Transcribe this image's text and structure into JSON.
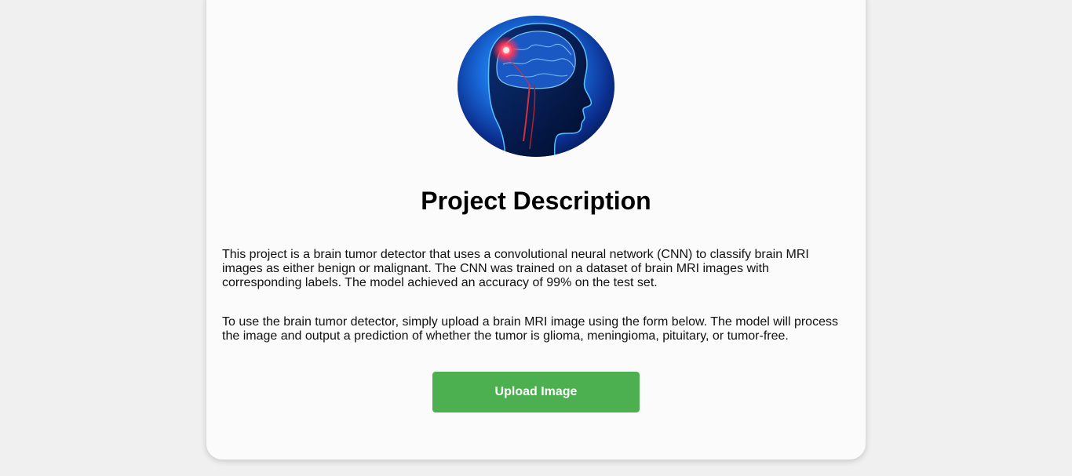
{
  "hero": {
    "image_subject": "brain-scan-head-illustration"
  },
  "main": {
    "title": "Project Description",
    "paragraph_1": "This project is a brain tumor detector that uses a convolutional neural network (CNN) to classify brain MRI images as either benign or malignant. The CNN was trained on a dataset of brain MRI images with corresponding labels. The model achieved an accuracy of 99% on the test set.",
    "paragraph_2": "To use the brain tumor detector, simply upload a brain MRI image using the form below. The model will process the image and output a prediction of whether the tumor is glioma, meningioma, pituitary, or tumor-free.",
    "upload_button_label": "Upload Image"
  },
  "colors": {
    "page_background": "#f0f0f0",
    "card_background": "#fbfbfb",
    "button_background": "#4caf50",
    "button_text": "#ffffff"
  }
}
